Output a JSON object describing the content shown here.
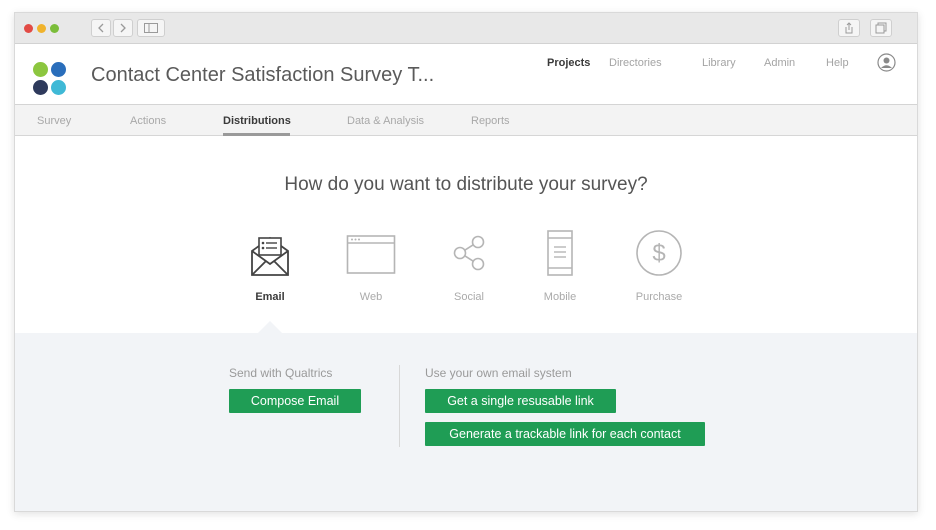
{
  "colors": {
    "accent_green": "#1f9d55",
    "logo": [
      "#8cc63f",
      "#2a6ebb",
      "#2e3a5c",
      "#3fb9d6"
    ]
  },
  "header": {
    "title": "Contact Center Satisfaction Survey T...",
    "nav": [
      {
        "label": "Projects",
        "active": true
      },
      {
        "label": "Directories",
        "active": false
      },
      {
        "label": "Library",
        "active": false
      },
      {
        "label": "Admin",
        "active": false
      },
      {
        "label": "Help",
        "active": false
      }
    ]
  },
  "tabs": [
    {
      "label": "Survey",
      "active": false
    },
    {
      "label": "Actions",
      "active": false
    },
    {
      "label": "Distributions",
      "active": true
    },
    {
      "label": "Data & Analysis",
      "active": false
    },
    {
      "label": "Reports",
      "active": false
    }
  ],
  "main": {
    "question": "How do you want to distribute your survey?",
    "options": [
      {
        "label": "Email",
        "icon": "envelope-icon",
        "active": true
      },
      {
        "label": "Web",
        "icon": "browser-window-icon",
        "active": false
      },
      {
        "label": "Social",
        "icon": "share-icon",
        "active": false
      },
      {
        "label": "Mobile",
        "icon": "mobile-phone-icon",
        "active": false
      },
      {
        "label": "Purchase",
        "icon": "dollar-icon",
        "active": false
      }
    ]
  },
  "email_panel": {
    "qualtrics_label": "Send with Qualtrics",
    "compose_button": "Compose Email",
    "own_system_label": "Use your own email system",
    "single_link_button": "Get a single resusable link",
    "trackable_link_button": "Generate a trackable link for each contact"
  }
}
